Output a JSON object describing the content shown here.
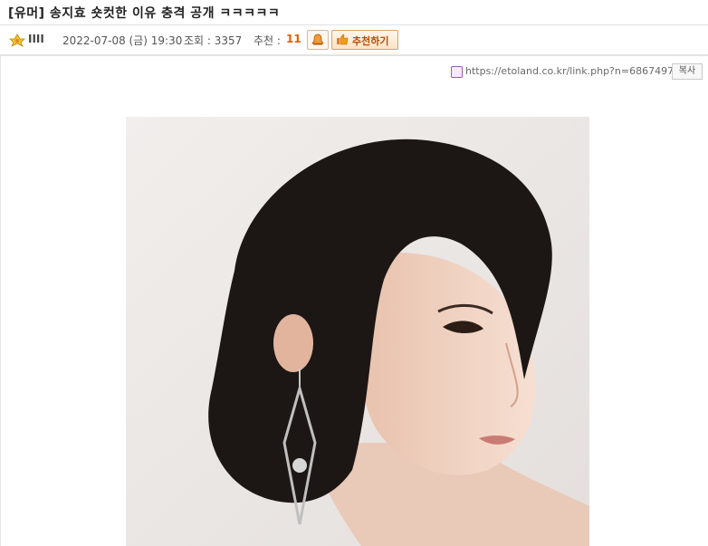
{
  "post": {
    "title": "[유머] 송지효 숏컷한 이유 충격 공개 ㅋㅋㅋㅋㅋ"
  },
  "meta": {
    "author": "IIII",
    "date": "2022-07-08 (금) 19:30",
    "views": "조회 : 3357",
    "recommend_label": "추천 :",
    "recommend_count": "11",
    "recommend_button": "추천하기"
  },
  "link": {
    "url": "https://etoland.co.kr/link.php?n=6867497",
    "copy_label": "복사"
  },
  "colors": {
    "accent": "#e65c00",
    "border": "#e1e1e1"
  }
}
